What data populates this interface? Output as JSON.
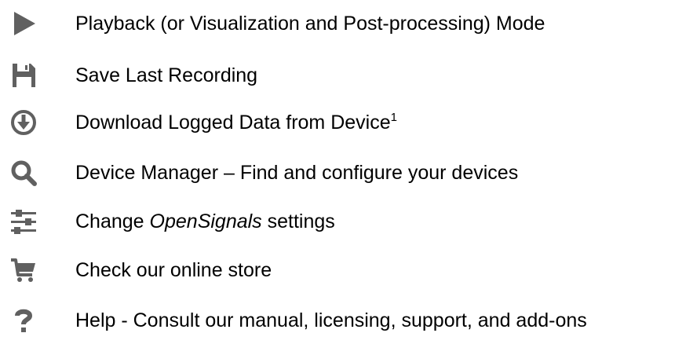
{
  "colors": {
    "icon": "#606060",
    "text": "#000000",
    "background": "#ffffff"
  },
  "items": [
    {
      "icon": "play-icon",
      "label": "Playback (or Visualization and Post-processing) Mode"
    },
    {
      "icon": "save-icon",
      "label": "Save Last Recording"
    },
    {
      "icon": "download-icon",
      "label": "Download Logged Data from Device",
      "superscript": "1"
    },
    {
      "icon": "search-icon",
      "label": "Device Manager – Find and configure your devices"
    },
    {
      "icon": "settings-sliders-icon",
      "label_prefix": "Change ",
      "label_emphasis": "OpenSignals",
      "label_suffix": " settings"
    },
    {
      "icon": "cart-icon",
      "label": "Check our online store"
    },
    {
      "icon": "help-icon",
      "label": "Help - Consult our manual, licensing, support, and add-ons"
    }
  ]
}
